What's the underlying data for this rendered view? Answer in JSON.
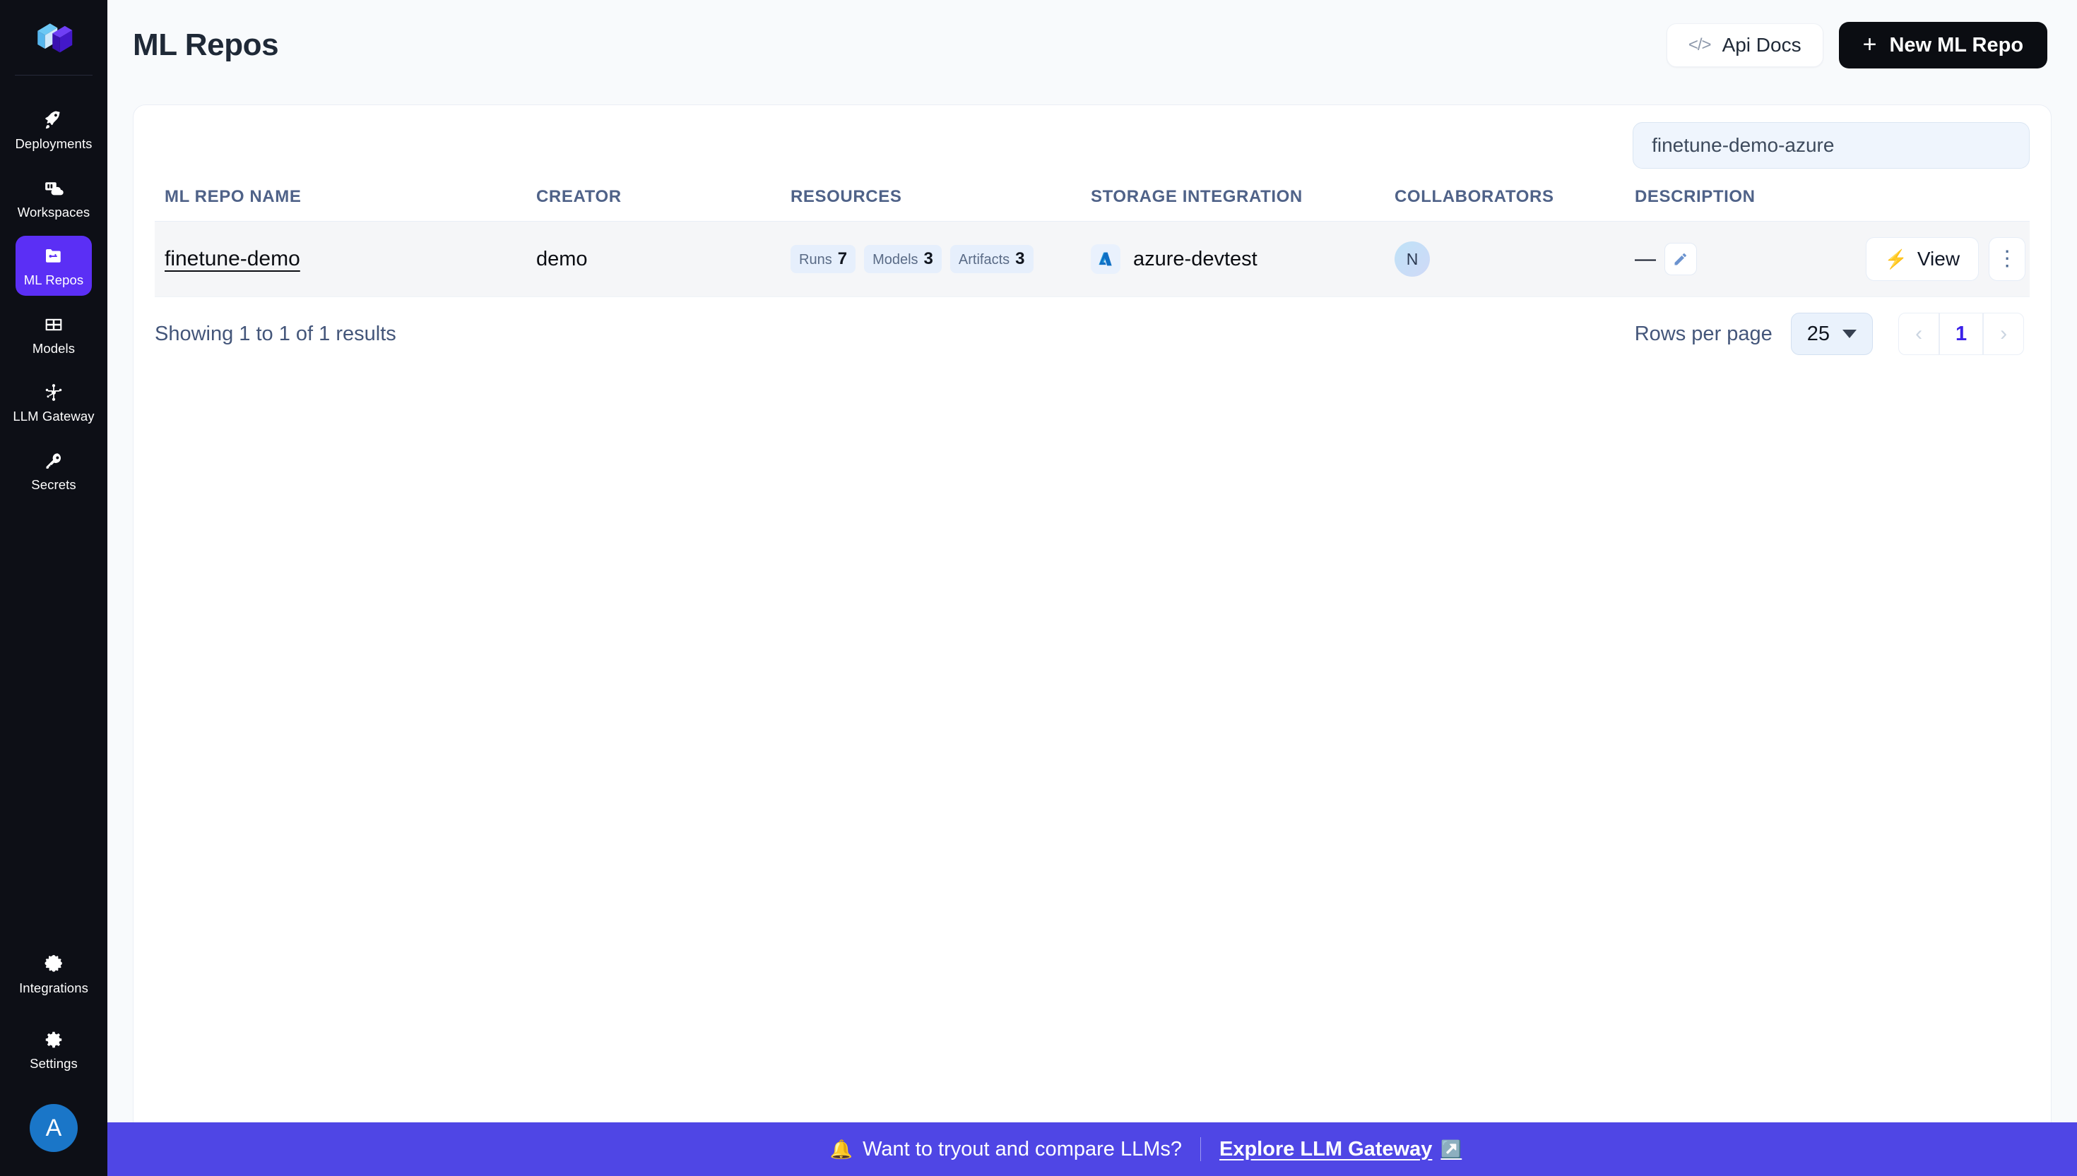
{
  "sidebar": {
    "logo_icon": "cube-logo-icon",
    "items": [
      {
        "label": "Deployments",
        "icon": "rocket-icon",
        "active": false
      },
      {
        "label": "Workspaces",
        "icon": "workspace-cloud-icon",
        "active": false
      },
      {
        "label": "ML Repos",
        "icon": "repo-folder-icon",
        "active": true
      },
      {
        "label": "Models",
        "icon": "grid-models-icon",
        "active": false
      },
      {
        "label": "LLM Gateway",
        "icon": "network-nodes-icon",
        "active": false
      },
      {
        "label": "Secrets",
        "icon": "key-icon",
        "active": false
      }
    ],
    "bottom_items": [
      {
        "label": "Integrations",
        "icon": "puzzle-icon"
      },
      {
        "label": "Settings",
        "icon": "gear-icon"
      }
    ],
    "avatar": {
      "initial": "A",
      "color": "#1a76c8"
    }
  },
  "header": {
    "title": "ML Repos",
    "api_docs_label": "Api Docs",
    "api_docs_icon": "code-brackets-icon",
    "new_repo_label": "New ML Repo",
    "new_repo_icon": "plus-icon"
  },
  "search": {
    "value": "finetune-demo-azure",
    "placeholder": "finetune-demo-azure"
  },
  "table": {
    "columns": [
      "ML REPO NAME",
      "CREATOR",
      "RESOURCES",
      "STORAGE INTEGRATION",
      "COLLABORATORS",
      "DESCRIPTION"
    ],
    "rows": [
      {
        "name": "finetune-demo",
        "creator": "demo",
        "resources": [
          {
            "label": "Runs",
            "count": "7"
          },
          {
            "label": "Models",
            "count": "3"
          },
          {
            "label": "Artifacts",
            "count": "3"
          }
        ],
        "storage_integration": "azure-devtest",
        "storage_icon": "azure-icon",
        "collaborator_initial": "N",
        "description": "—",
        "edit_icon": "pencil-icon",
        "view_label": "View",
        "view_icon": "bolt-icon",
        "more_icon": "kebab-menu-icon"
      }
    ]
  },
  "pagination": {
    "results_text": "Showing 1 to 1 of 1 results",
    "rows_per_page_label": "Rows per page",
    "rows_per_page_value": "25",
    "rows_per_page_options": [
      "25"
    ],
    "prev_icon": "chevron-left-icon",
    "next_icon": "chevron-right-icon",
    "current_page": "1"
  },
  "banner": {
    "bell_icon": "bell-icon",
    "text": "Want to tryout and compare LLMs?",
    "link_label": "Explore LLM Gateway",
    "link_icon": "external-link-icon",
    "close_icon": "close-icon",
    "background": "#4f46e5"
  },
  "colors": {
    "accent": "#5b2ff5",
    "sidebar_bg": "#0d0f16",
    "page_bg": "#f8fafc",
    "banner": "#4f46e5",
    "page_number": "#3b21e8"
  }
}
